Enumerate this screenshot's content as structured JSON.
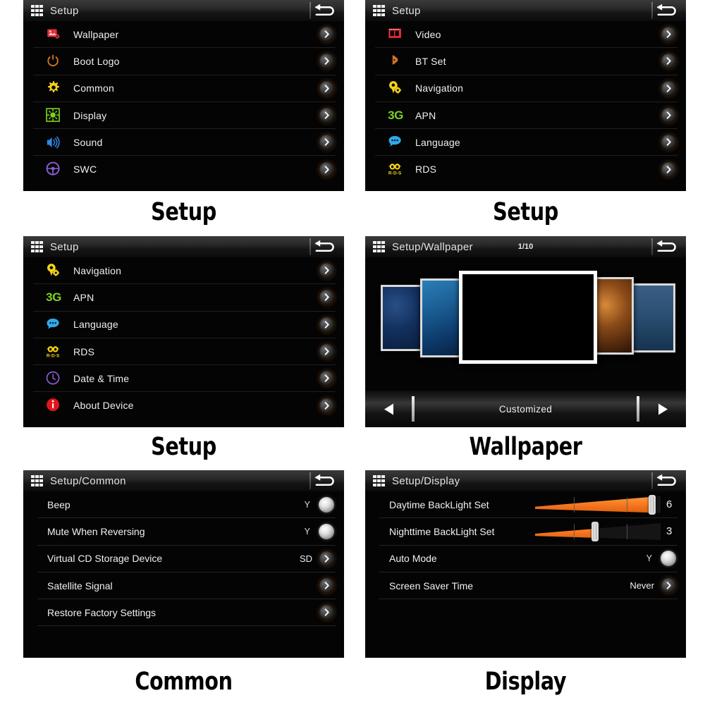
{
  "app": {
    "device": "car-head-unit",
    "header_icon": "app-grid-icon",
    "back_icon": "back-arrow-icon",
    "chevron_icon": "chevron-right-icon",
    "knob_icon": "toggle-knob-icon"
  },
  "colors": {
    "screen_bg": "#050404",
    "header_top": "#3a3a3a",
    "accent_orange": "#f4751f",
    "text": "#f0f0f0",
    "page_bg": "#ffffff",
    "caption": "#000000"
  },
  "panels": [
    {
      "id": "setup-page-1",
      "caption": "Setup",
      "title": "Setup",
      "type": "menu",
      "rows": [
        {
          "label": "Wallpaper",
          "icon": "wallpaper-icon",
          "icon_color": "#e8303a",
          "control": "chevron"
        },
        {
          "label": "Boot Logo",
          "icon": "power-icon",
          "icon_color": "#d4791f",
          "control": "chevron"
        },
        {
          "label": "Common",
          "icon": "gear-icon",
          "icon_color": "#f5d416",
          "control": "chevron"
        },
        {
          "label": "Display",
          "icon": "brightness-icon",
          "icon_color": "#7bd321",
          "control": "chevron"
        },
        {
          "label": "Sound",
          "icon": "speaker-icon",
          "icon_color": "#2f86e8",
          "control": "chevron"
        },
        {
          "label": "SWC",
          "icon": "steering-wheel-icon",
          "icon_color": "#8a5fd6",
          "control": "chevron"
        }
      ]
    },
    {
      "id": "setup-page-2",
      "caption": "Setup",
      "title": "Setup",
      "type": "menu",
      "rows": [
        {
          "label": "Video",
          "icon": "video-icon",
          "icon_color": "#e8303a",
          "control": "chevron"
        },
        {
          "label": "BT Set",
          "icon": "bluetooth-icon",
          "icon_color": "#d4791f",
          "control": "chevron"
        },
        {
          "label": "Navigation",
          "icon": "navigation-pin-icon",
          "icon_color": "#f5d416",
          "control": "chevron"
        },
        {
          "label": "APN",
          "icon": "3g-icon",
          "icon_color": "#7bd321",
          "control": "chevron"
        },
        {
          "label": "Language",
          "icon": "speech-bubble-icon",
          "icon_color": "#31a9e8",
          "control": "chevron"
        },
        {
          "label": "RDS",
          "icon": "rds-icon",
          "icon_color": "#f5d416",
          "control": "chevron"
        }
      ]
    },
    {
      "id": "setup-page-3",
      "caption": "Setup",
      "title": "Setup",
      "type": "menu",
      "rows": [
        {
          "label": "Navigation",
          "icon": "navigation-pin-icon",
          "icon_color": "#f5d416",
          "control": "chevron"
        },
        {
          "label": "APN",
          "icon": "3g-icon",
          "icon_color": "#7bd321",
          "control": "chevron"
        },
        {
          "label": "Language",
          "icon": "speech-bubble-icon",
          "icon_color": "#31a9e8",
          "control": "chevron"
        },
        {
          "label": "RDS",
          "icon": "rds-icon",
          "icon_color": "#f5d416",
          "control": "chevron"
        },
        {
          "label": "Date & Time",
          "icon": "clock-icon",
          "icon_color": "#8a5fd6",
          "control": "chevron"
        },
        {
          "label": "About Device",
          "icon": "info-icon",
          "icon_color": "#e4141c",
          "control": "chevron"
        }
      ]
    },
    {
      "id": "wallpaper-page",
      "caption": "Wallpaper",
      "title": "Setup/Wallpaper",
      "type": "wallpaper",
      "page_indicator": "1/10",
      "source_label": "Customized",
      "prev_icon": "triangle-left-icon",
      "next_icon": "triangle-right-icon",
      "thumbs": [
        {
          "name": "wallpaper-thumb-1",
          "style": "night-sky-stars",
          "selected": false
        },
        {
          "name": "wallpaper-thumb-2",
          "style": "blue-nebula",
          "selected": false
        },
        {
          "name": "wallpaper-thumb-3",
          "style": "black-current",
          "selected": true
        },
        {
          "name": "wallpaper-thumb-4",
          "style": "orange-bokeh",
          "selected": false
        },
        {
          "name": "wallpaper-thumb-5",
          "style": "blue-grass-dusk",
          "selected": false
        }
      ]
    },
    {
      "id": "common-page",
      "caption": "Common",
      "title": "Setup/Common",
      "type": "settings",
      "rows": [
        {
          "label": "Beep",
          "value": "Y",
          "control": "knob"
        },
        {
          "label": "Mute When Reversing",
          "value": "Y",
          "control": "knob"
        },
        {
          "label": "Virtual CD Storage Device",
          "value": "SD",
          "control": "chevron"
        },
        {
          "label": "Satellite Signal",
          "value": "",
          "control": "chevron"
        },
        {
          "label": "Restore Factory Settings",
          "value": "",
          "control": "chevron"
        }
      ]
    },
    {
      "id": "display-page",
      "caption": "Display",
      "title": "Setup/Display",
      "type": "settings",
      "rows": [
        {
          "label": "Daytime BackLight Set",
          "value": "6",
          "control": "slider",
          "slider_pct": 93,
          "slider_max": 10
        },
        {
          "label": "Nighttime BackLight Set",
          "value": "3",
          "control": "slider",
          "slider_pct": 48,
          "slider_max": 10
        },
        {
          "label": "Auto Mode",
          "value": "Y",
          "control": "knob"
        },
        {
          "label": "Screen Saver Time",
          "value": "Never",
          "control": "chevron"
        }
      ]
    }
  ]
}
